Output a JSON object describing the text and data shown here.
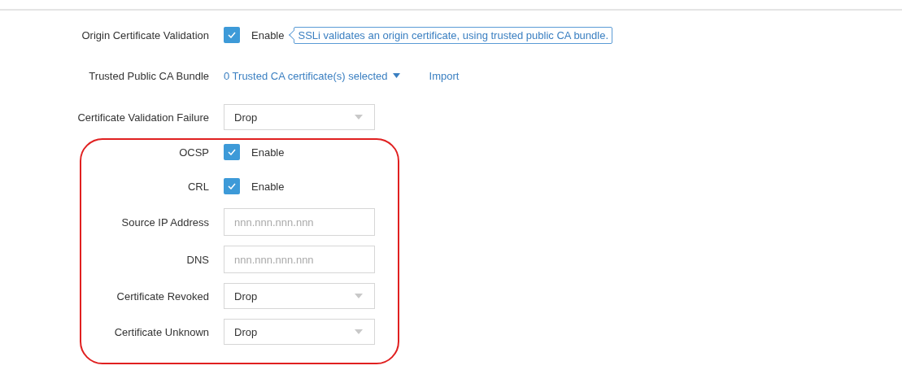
{
  "rows": [
    {
      "kind": "checkbox",
      "label": "Origin Certificate Validation",
      "checked": true,
      "option": "Enable",
      "hint": "SSLi validates an origin certificate, using trusted public CA bundle.",
      "highlighted": false
    },
    {
      "kind": "link",
      "label": "Trusted Public CA Bundle",
      "value": "0 Trusted CA certificate(s) selected",
      "action": "Import",
      "highlighted": false
    },
    {
      "kind": "select",
      "label": "Certificate Validation Failure",
      "value": "Drop",
      "highlighted": false
    },
    {
      "kind": "checkbox",
      "label": "OCSP",
      "checked": true,
      "option": "Enable",
      "highlighted": true
    },
    {
      "kind": "checkbox",
      "label": "CRL",
      "checked": true,
      "option": "Enable",
      "highlighted": true
    },
    {
      "kind": "input",
      "label": "Source IP Address",
      "placeholder": "nnn.nnn.nnn.nnn",
      "highlighted": true
    },
    {
      "kind": "input",
      "label": "DNS",
      "placeholder": "nnn.nnn.nnn.nnn",
      "highlighted": true
    },
    {
      "kind": "select",
      "label": "Certificate Revoked",
      "value": "Drop",
      "highlighted": true
    },
    {
      "kind": "select",
      "label": "Certificate Unknown",
      "value": "Drop",
      "highlighted": true
    }
  ]
}
